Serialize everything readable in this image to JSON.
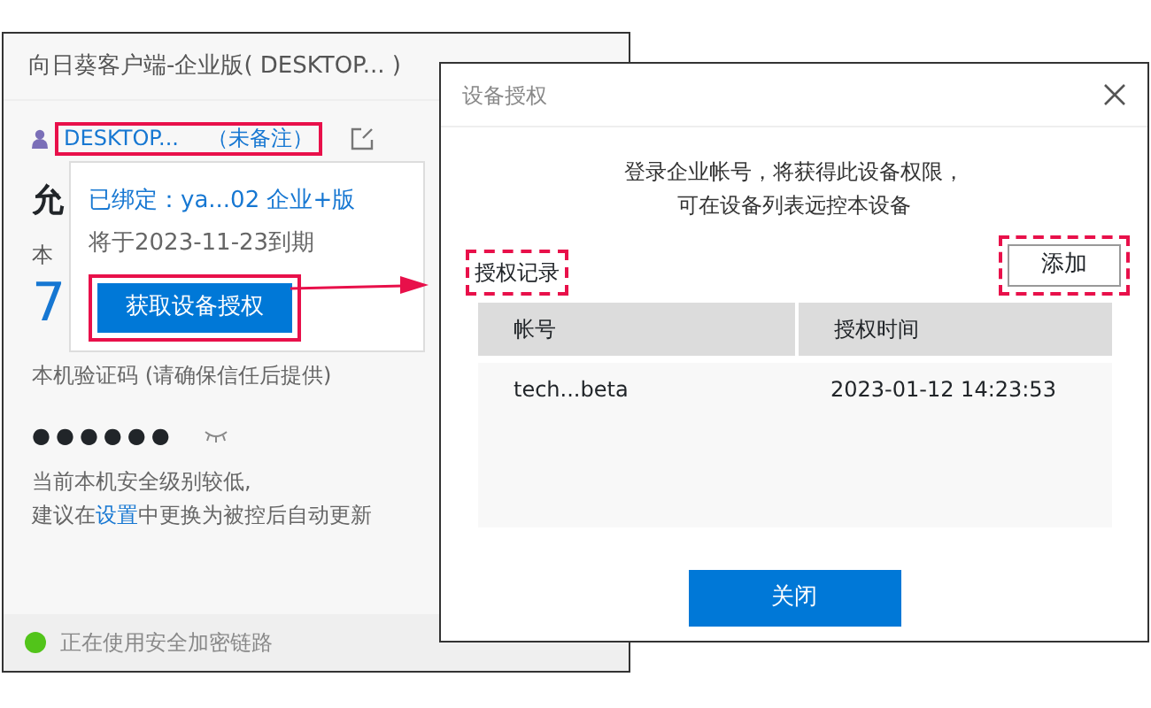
{
  "main_window": {
    "title": "向日葵客户端-企业版( DESKTOP... )",
    "device_name": "DESKTOP...",
    "remark": "（未备注）",
    "hidden_texts": [
      "允",
      "本",
      "7"
    ],
    "popup": {
      "bound": "已绑定：ya...02 企业+版",
      "expiry": "将于2023-11-23到期",
      "button": "获取设备授权"
    },
    "code_label": "本机验证码 (请确保信任后提供)",
    "code": "●●●●●●",
    "warning": {
      "line1": "当前本机安全级别较低,",
      "before": "建议在",
      "link": "设置",
      "after": "中更换为被控后自动更新"
    },
    "status": {
      "text": "正在使用安全加密链路",
      "color": "#52c41a"
    }
  },
  "dialog": {
    "title": "设备授权",
    "message": [
      "登录企业帐号，将获得此设备权限，",
      "可在设备列表远控本设备"
    ],
    "section": "授权记录",
    "add_button": "添加",
    "columns": [
      "帐号",
      "授权时间"
    ],
    "rows": [
      [
        "tech...beta",
        "2023-01-12 14:23:53"
      ]
    ],
    "close_button": "关闭"
  }
}
